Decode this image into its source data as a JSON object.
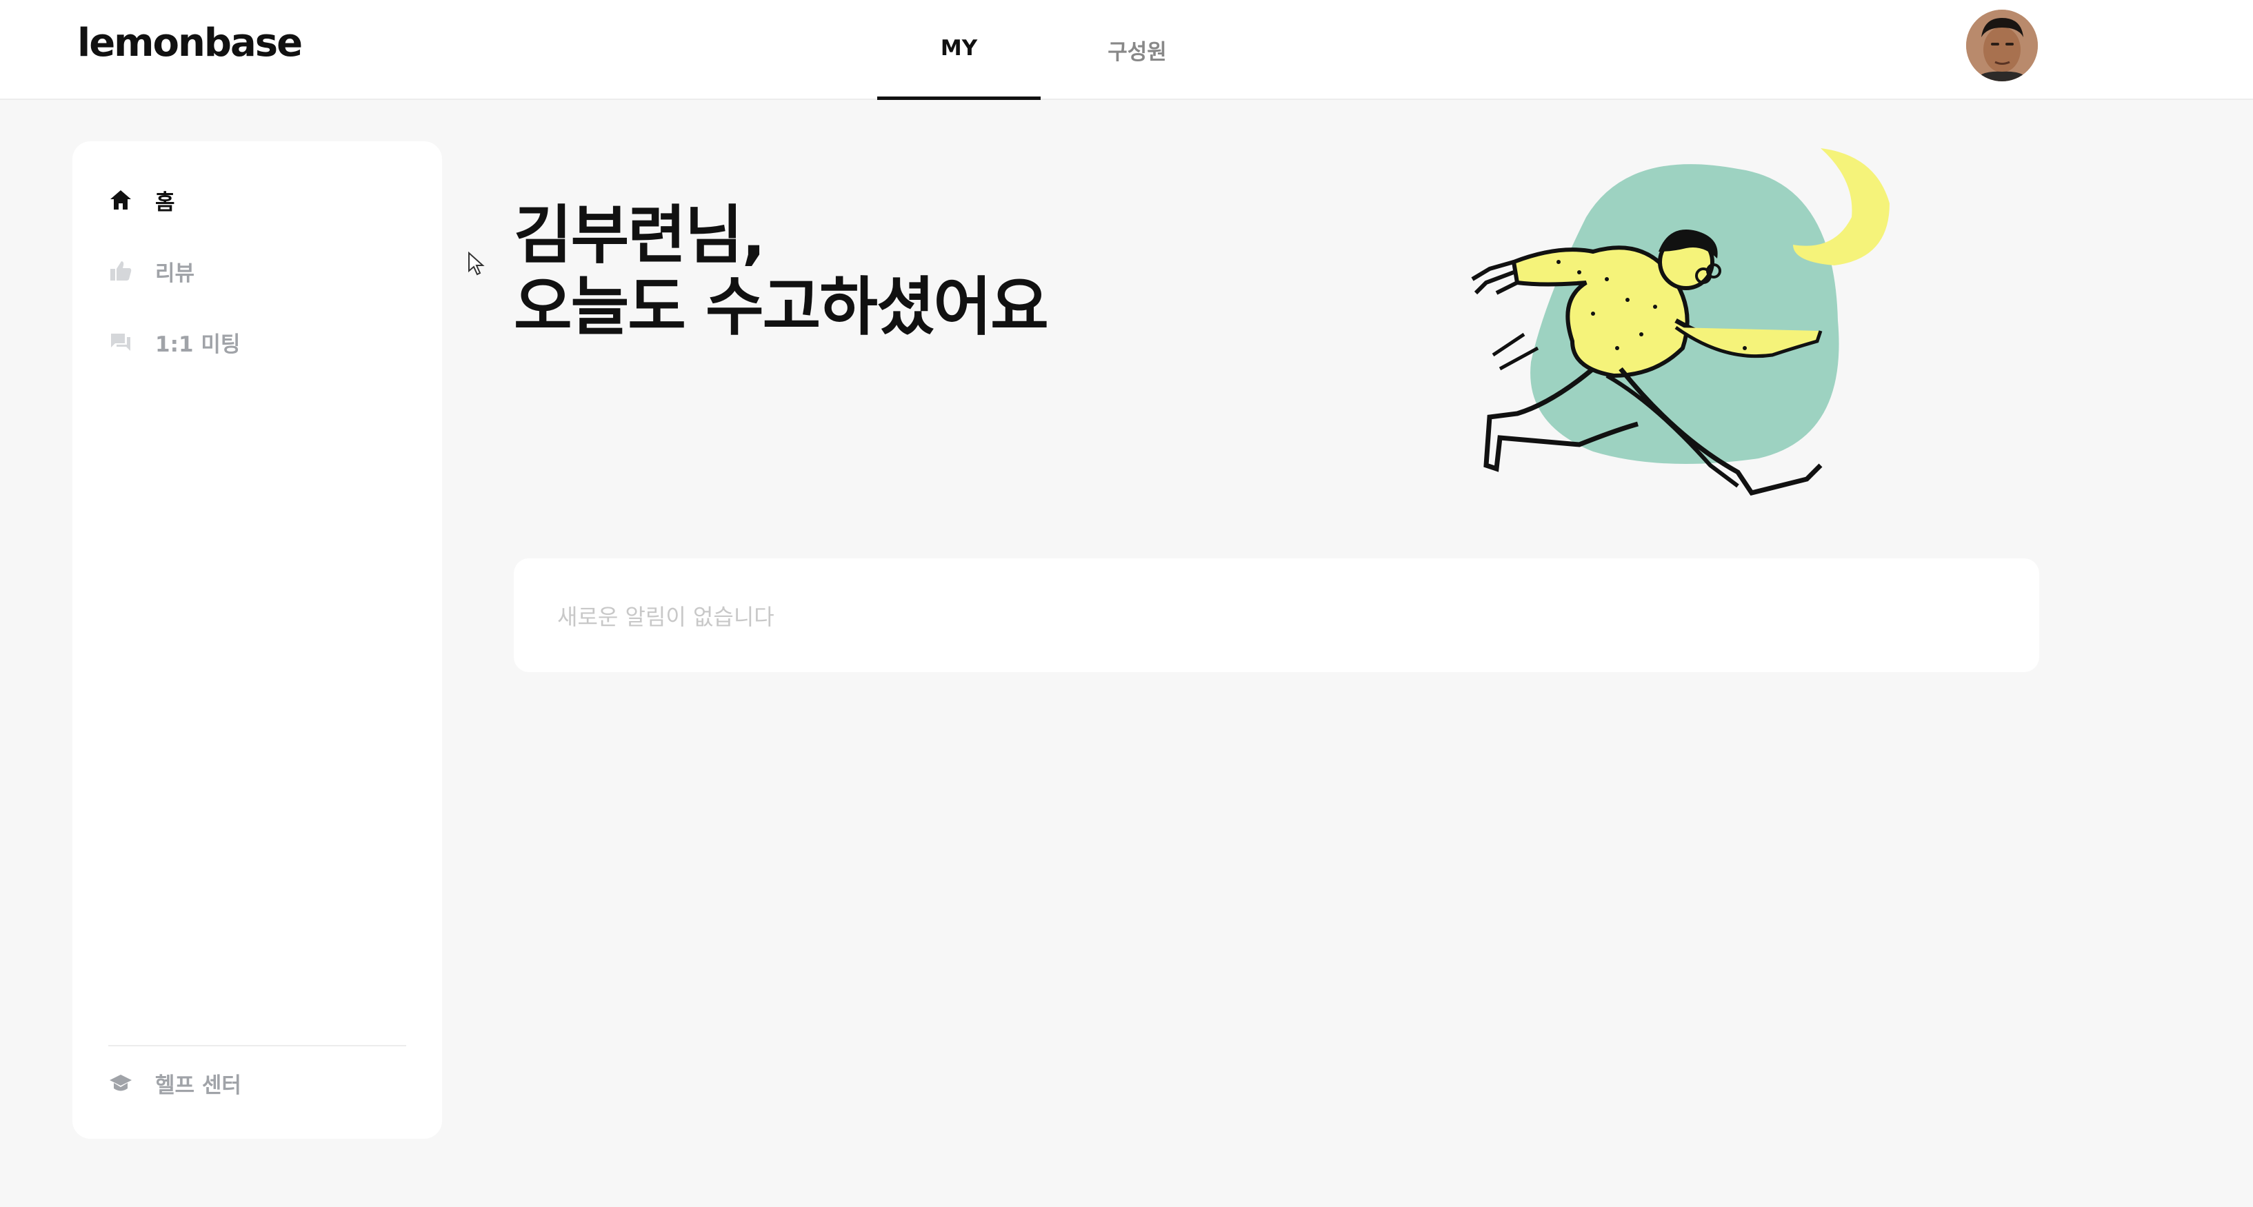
{
  "header": {
    "logo": "lemonbase",
    "tabs": [
      {
        "label": "MY",
        "active": true
      },
      {
        "label": "구성원",
        "active": false
      }
    ],
    "avatar_icon": "user-avatar"
  },
  "sidebar": {
    "items": [
      {
        "label": "홈",
        "icon": "home-icon",
        "active": true
      },
      {
        "label": "리뷰",
        "icon": "thumbs-up-icon",
        "active": false
      },
      {
        "label": "1:1 미팅",
        "icon": "chat-icon",
        "active": false
      }
    ],
    "footer": {
      "label": "헬프 센터",
      "icon": "graduation-cap-icon"
    }
  },
  "main": {
    "greeting_line1": "김부련님,",
    "greeting_line2": "오늘도 수고하셨어요",
    "notifications_empty": "새로운 알림이 없습니다"
  },
  "colors": {
    "background": "#f7f7f7",
    "card": "#ffffff",
    "text_primary": "#111111",
    "text_muted": "#a0a3a8",
    "illustration_mint": "#9dd2c1",
    "illustration_yellow": "#f5f37a"
  }
}
